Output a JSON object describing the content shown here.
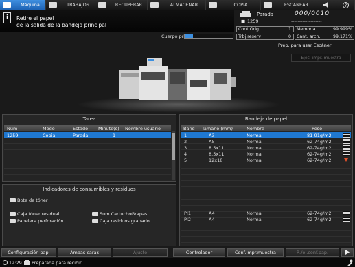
{
  "tabs": [
    {
      "label": "Máquina",
      "icon": "machine-icon",
      "active": true
    },
    {
      "label": "TRABAJOS",
      "icon": "jobs-icon"
    },
    {
      "label": "RECUPERAR",
      "icon": "retrieve-icon"
    },
    {
      "label": "ALMACENAR",
      "icon": "store-icon"
    },
    {
      "label": "COPIA",
      "icon": "copy-icon"
    },
    {
      "label": "ESCANEAR",
      "icon": "scan-icon"
    }
  ],
  "message": {
    "line1": "Retire el papel",
    "line2": "de la salida de la bandeja principal"
  },
  "status": {
    "state_label": "Parada",
    "counter": "000/0010",
    "job_number": "1259",
    "dashes": "-------------------",
    "cont_orig_label": "Cont.Orig.",
    "cont_orig_value": "1",
    "memoria_label": "Memoria",
    "memoria_value": "99.999%",
    "trbj_reserv_label": "Trbj.reserv",
    "trbj_reserv_value": "0",
    "cant_arch_label": "Cant. arch.",
    "cant_arch_value": "99.171%"
  },
  "cuerpo": {
    "label": "Cuerpo prin.",
    "fill_fraction": 0.17
  },
  "scanner_status": "Prep. para usar Escáner",
  "ejec_button": "Ejec. impr. muestra",
  "tarea": {
    "title": "Tarea",
    "columns": [
      "Núm",
      "Modo",
      "Estado",
      "Minuto(s)",
      "Nombre usuario"
    ],
    "rows": [
      {
        "num": "1259",
        "modo": "Copia",
        "estado": "Parada",
        "minutos": "1",
        "usuario": "--------------"
      }
    ]
  },
  "bandeja": {
    "title": "Bandeja de papel",
    "columns": [
      "Band",
      "Tamaño (mm)",
      "Nombre",
      "Peso"
    ],
    "rows": [
      {
        "band": "1",
        "size": "A3",
        "name": "Normal",
        "weight": "81-91g/m2"
      },
      {
        "band": "2",
        "size": "A5",
        "name": "Normal",
        "weight": "62-74g/m2"
      },
      {
        "band": "3",
        "size": "8.5x11",
        "name": "Normal",
        "weight": "62-74g/m2"
      },
      {
        "band": "4",
        "size": "8.5x11",
        "name": "Normal",
        "weight": "62-74g/m2"
      },
      {
        "band": "5",
        "size": "12x18",
        "name": "Normal",
        "weight": "62-74g/m2"
      }
    ],
    "pi_rows": [
      {
        "band": "PI1",
        "size": "A4",
        "name": "Normal",
        "weight": "62-74g/m2"
      },
      {
        "band": "PI2",
        "size": "A4",
        "name": "Normal",
        "weight": "62-74g/m2"
      }
    ]
  },
  "consumibles": {
    "title": "Indicadores de consumibles y residuos",
    "bote_toner": "Bote de tóner",
    "caja_toner": "Caja tóner residual",
    "papelera": "Papelera perforación",
    "sum_cartucho": "Sum.CartuchoGrapas",
    "caja_residuos": "Caja residuos grapado"
  },
  "bottom_buttons": [
    {
      "label": "Configuración pap.",
      "enabled": true
    },
    {
      "label": "Ambas caras",
      "enabled": true
    },
    {
      "label": "Ajuste",
      "enabled": false
    },
    {
      "label": "Controlador",
      "enabled": true
    },
    {
      "label": "Conf.impr.muestra",
      "enabled": true
    },
    {
      "label": "R./el.conf.pap.",
      "enabled": false
    }
  ],
  "footer": {
    "time": "12:29",
    "status": "Preparada para recibir"
  },
  "colors": {
    "accent": "#1f78d1",
    "warning": "#e2502a"
  }
}
